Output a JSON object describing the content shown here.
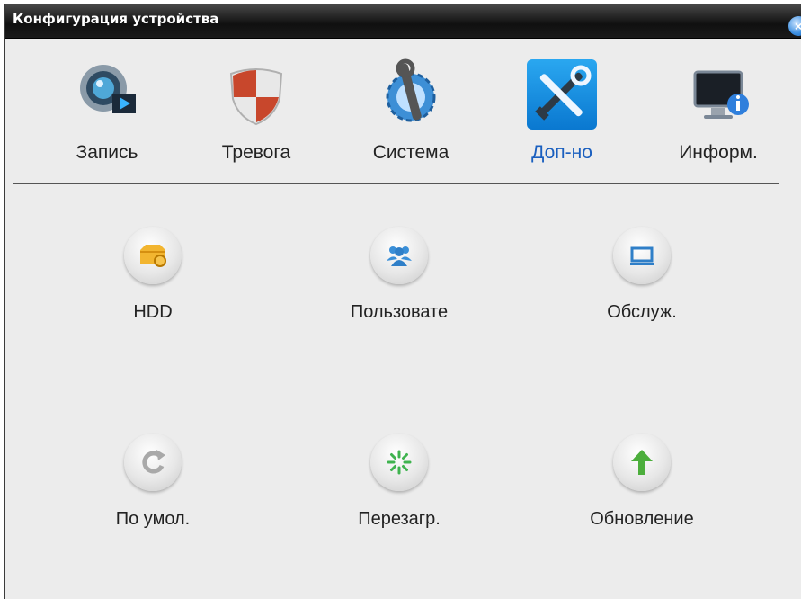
{
  "window": {
    "title": "Конфигурация устройства",
    "close_glyph": "×"
  },
  "tabs": [
    {
      "label": "Запись",
      "icon": "camera-icon"
    },
    {
      "label": "Тревога",
      "icon": "shield-icon"
    },
    {
      "label": "Система",
      "icon": "wrench-gear-icon"
    },
    {
      "label": "Доп-но",
      "icon": "tools-icon",
      "active": true
    },
    {
      "label": "Информ.",
      "icon": "monitor-info-icon"
    }
  ],
  "items": [
    {
      "label": "HDD",
      "icon": "hdd-icon"
    },
    {
      "label": "Пользовате",
      "icon": "users-icon"
    },
    {
      "label": "Обслуж.",
      "icon": "maintenance-icon"
    },
    {
      "label": "По умол.",
      "icon": "reset-icon"
    },
    {
      "label": "Перезагр.",
      "icon": "restart-icon"
    },
    {
      "label": "Обновление",
      "icon": "upgrade-icon"
    }
  ],
  "colors": {
    "active_tab": "#1a5fbf",
    "background": "#ececec",
    "titlebar": "#1a1a1a"
  }
}
